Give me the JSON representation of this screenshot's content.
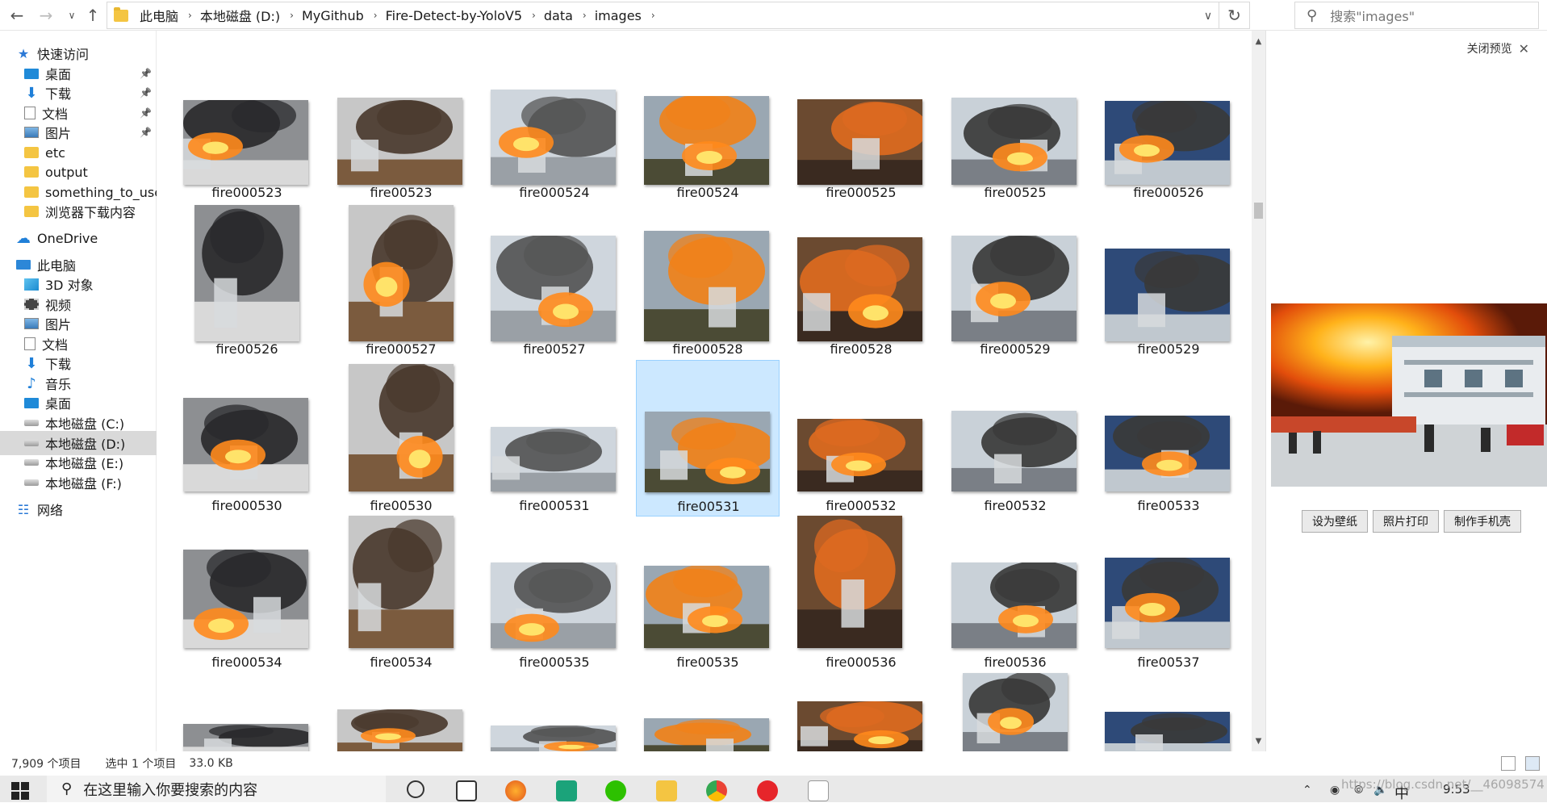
{
  "nav": {
    "back_icon": "arrow-left-icon",
    "forward_icon": "arrow-right-icon",
    "recent_icon": "chevron-down-icon",
    "up_icon": "arrow-up-icon"
  },
  "address": {
    "crumbs": [
      "此电脑",
      "本地磁盘 (D:)",
      "MyGithub",
      "Fire-Detect-by-YoloV5",
      "data",
      "images"
    ]
  },
  "search": {
    "placeholder": "搜索\"images\""
  },
  "sidebar": {
    "items": [
      {
        "label": "快速访问",
        "icon": "star-icon",
        "pinned": false
      },
      {
        "label": "桌面",
        "icon": "desktop-icon",
        "pinned": true
      },
      {
        "label": "下载",
        "icon": "download-icon",
        "pinned": true
      },
      {
        "label": "文档",
        "icon": "document-icon",
        "pinned": true
      },
      {
        "label": "图片",
        "icon": "pictures-icon",
        "pinned": true
      },
      {
        "label": "etc",
        "icon": "folder-icon",
        "pinned": false
      },
      {
        "label": "output",
        "icon": "folder-icon",
        "pinned": false
      },
      {
        "label": "something_to_use",
        "icon": "folder-icon",
        "pinned": false
      },
      {
        "label": "浏览器下载内容",
        "icon": "folder-icon",
        "pinned": false
      },
      {
        "label": "OneDrive",
        "icon": "cloud-icon",
        "pinned": false
      },
      {
        "label": "此电脑",
        "icon": "computer-icon",
        "pinned": false
      },
      {
        "label": "3D 对象",
        "icon": "3d-objects-icon",
        "pinned": false
      },
      {
        "label": "视频",
        "icon": "video-icon",
        "pinned": false
      },
      {
        "label": "图片",
        "icon": "pictures-icon",
        "pinned": false
      },
      {
        "label": "文档",
        "icon": "document-icon",
        "pinned": false
      },
      {
        "label": "下载",
        "icon": "download-icon",
        "pinned": false
      },
      {
        "label": "音乐",
        "icon": "music-icon",
        "pinned": false
      },
      {
        "label": "桌面",
        "icon": "desktop-icon",
        "pinned": false
      },
      {
        "label": "本地磁盘 (C:)",
        "icon": "drive-icon",
        "pinned": false
      },
      {
        "label": "本地磁盘 (D:)",
        "icon": "drive-icon",
        "pinned": false,
        "selected": true
      },
      {
        "label": "本地磁盘 (E:)",
        "icon": "drive-icon",
        "pinned": false
      },
      {
        "label": "本地磁盘 (F:)",
        "icon": "drive-icon",
        "pinned": false
      },
      {
        "label": "网络",
        "icon": "network-icon",
        "pinned": false
      }
    ]
  },
  "files": [
    {
      "name": "fire000523"
    },
    {
      "name": "fire00523"
    },
    {
      "name": "fire000524"
    },
    {
      "name": "fire00524"
    },
    {
      "name": "fire000525"
    },
    {
      "name": "fire00525"
    },
    {
      "name": "fire000526"
    },
    {
      "name": "fire00526"
    },
    {
      "name": "fire000527"
    },
    {
      "name": "fire00527"
    },
    {
      "name": "fire000528"
    },
    {
      "name": "fire00528"
    },
    {
      "name": "fire000529"
    },
    {
      "name": "fire00529"
    },
    {
      "name": "fire000530"
    },
    {
      "name": "fire00530"
    },
    {
      "name": "fire000531"
    },
    {
      "name": "fire00531",
      "selected": true
    },
    {
      "name": "fire000532"
    },
    {
      "name": "fire00532"
    },
    {
      "name": "fire00533"
    },
    {
      "name": "fire000534"
    },
    {
      "name": "fire00534"
    },
    {
      "name": "fire000535"
    },
    {
      "name": "fire00535"
    },
    {
      "name": "fire000536"
    },
    {
      "name": "fire00536"
    },
    {
      "name": "fire00537"
    },
    {
      "name": ""
    },
    {
      "name": ""
    },
    {
      "name": ""
    },
    {
      "name": ""
    },
    {
      "name": ""
    },
    {
      "name": ""
    },
    {
      "name": ""
    }
  ],
  "preview": {
    "close_label": "关闭预览",
    "buttons": [
      "设为壁纸",
      "照片打印",
      "制作手机壳"
    ]
  },
  "status": {
    "item_count": "7,909 个项目",
    "selection": "选中 1 个项目",
    "size": "33.0 KB"
  },
  "taskbar": {
    "search_placeholder": "在这里输入你要搜索的内容",
    "ime": "中",
    "time": "9:53"
  },
  "watermark": "https://blog.csdn.net/__46098574"
}
